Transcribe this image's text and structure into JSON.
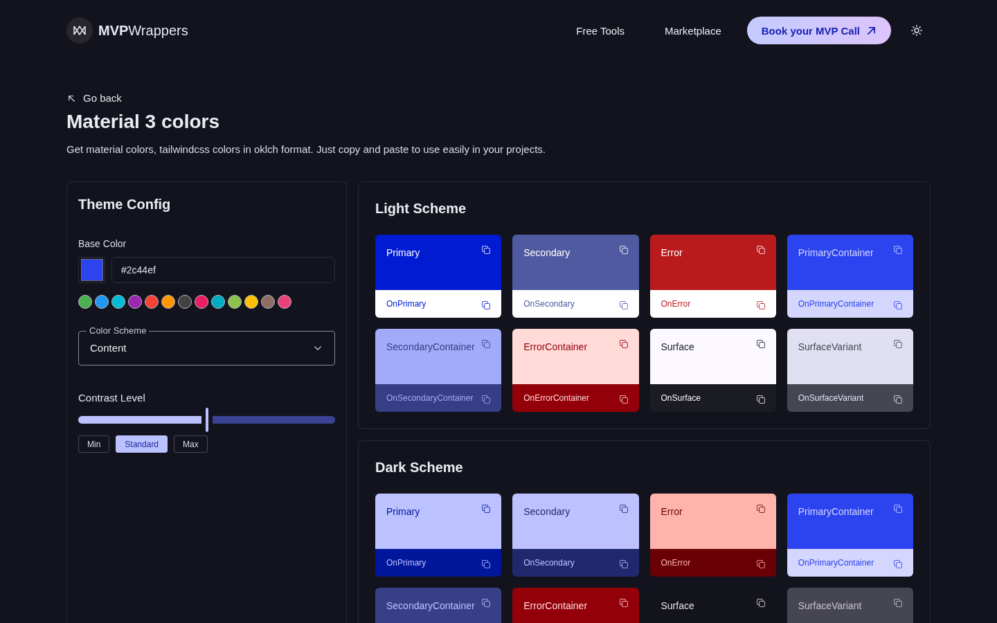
{
  "header": {
    "logo_text": "**MVP**Wrappers",
    "nav": [
      {
        "label": "Free Tools"
      },
      {
        "label": "Marketplace"
      }
    ],
    "cta": {
      "label": "Book your MVP Call"
    }
  },
  "back_link": {
    "label": "Go back"
  },
  "page": {
    "title": "Material 3 colors",
    "description": "Get material colors, tailwindcss colors in oklch format. Just copy and paste to use easily in your projects."
  },
  "theme_config": {
    "title": "Theme Config",
    "base_color": {
      "label": "Base Color",
      "value": "#2c44ef",
      "color": "#2c44ef"
    },
    "presets": [
      {
        "color": "#4caf50",
        "selected": false
      },
      {
        "color": "#2196f3",
        "selected": false
      },
      {
        "color": "#00bcd4",
        "selected": false
      },
      {
        "color": "#9c27b0",
        "selected": false
      },
      {
        "color": "#f44336",
        "selected": false
      },
      {
        "color": "#ff9800",
        "selected": false
      },
      {
        "color": "#424242",
        "selected": false
      },
      {
        "color": "#e91e63",
        "selected": false
      },
      {
        "color": "#00acc1",
        "selected": false
      },
      {
        "color": "#8bc34a",
        "selected": false
      },
      {
        "color": "#ffc107",
        "selected": false
      },
      {
        "color": "#8d6e63",
        "selected": false
      },
      {
        "color": "#ec407a",
        "selected": false
      }
    ],
    "color_scheme": {
      "label": "Color Scheme",
      "value": "Content"
    },
    "contrast": {
      "label": "Contrast Level",
      "level": 0.5,
      "options": [
        {
          "label": "Min",
          "selected": false
        },
        {
          "label": "Standard",
          "selected": true
        },
        {
          "label": "Max",
          "selected": false
        }
      ]
    }
  },
  "schemes": [
    {
      "title": "Light Scheme",
      "cards": [
        {
          "name": "Primary",
          "color": "#001bd1",
          "on": {
            "name": "OnPrimary",
            "color": "#ffffff"
          }
        },
        {
          "name": "Secondary",
          "color": "#505aa1",
          "on": {
            "name": "OnSecondary",
            "color": "#ffffff"
          }
        },
        {
          "name": "Error",
          "color": "#b91b1c",
          "on": {
            "name": "OnError",
            "color": "#ffffff"
          }
        },
        {
          "name": "PrimaryContainer",
          "color": "#2c44ef",
          "on": {
            "name": "OnPrimaryContainer",
            "color": "#d4d6fe"
          }
        },
        {
          "name": "SecondaryContainer",
          "color": "#a2abfa",
          "on": {
            "name": "OnSecondaryContainer",
            "color": "#363e86"
          }
        },
        {
          "name": "ErrorContainer",
          "color": "#ffdad6",
          "on": {
            "name": "OnErrorContainer",
            "color": "#93000a"
          }
        },
        {
          "name": "Surface",
          "color": "#fbf8ff",
          "on": {
            "name": "OnSurface",
            "color": "#1b1b22"
          }
        },
        {
          "name": "SurfaceVariant",
          "color": "#e1e0f3",
          "on": {
            "name": "OnSurfaceVariant",
            "color": "#464653"
          }
        }
      ]
    },
    {
      "title": "Dark Scheme",
      "cards": [
        {
          "name": "Primary",
          "color": "#bcc2ff",
          "on": {
            "name": "OnPrimary",
            "color": "#00179b"
          }
        },
        {
          "name": "Secondary",
          "color": "#bdc2ff",
          "on": {
            "name": "OnSecondary",
            "color": "#20286e"
          }
        },
        {
          "name": "Error",
          "color": "#ffb4ab",
          "on": {
            "name": "OnError",
            "color": "#690005"
          }
        },
        {
          "name": "PrimaryContainer",
          "color": "#2c44ef",
          "on": {
            "name": "OnPrimaryContainer",
            "color": "#d4d6fe"
          }
        },
        {
          "name": "SecondaryContainer",
          "color": "#383f87",
          "on": {
            "color": "#bdc2ff"
          }
        },
        {
          "name": "ErrorContainer",
          "color": "#93000a",
          "on": {
            "color": "#ffdad6"
          }
        },
        {
          "name": "Surface",
          "color": "#13131b",
          "on": {
            "color": "#e4e1ec"
          }
        },
        {
          "name": "SurfaceVariant",
          "color": "#464653",
          "on": {
            "color": "#c7c5d0"
          }
        }
      ]
    }
  ]
}
